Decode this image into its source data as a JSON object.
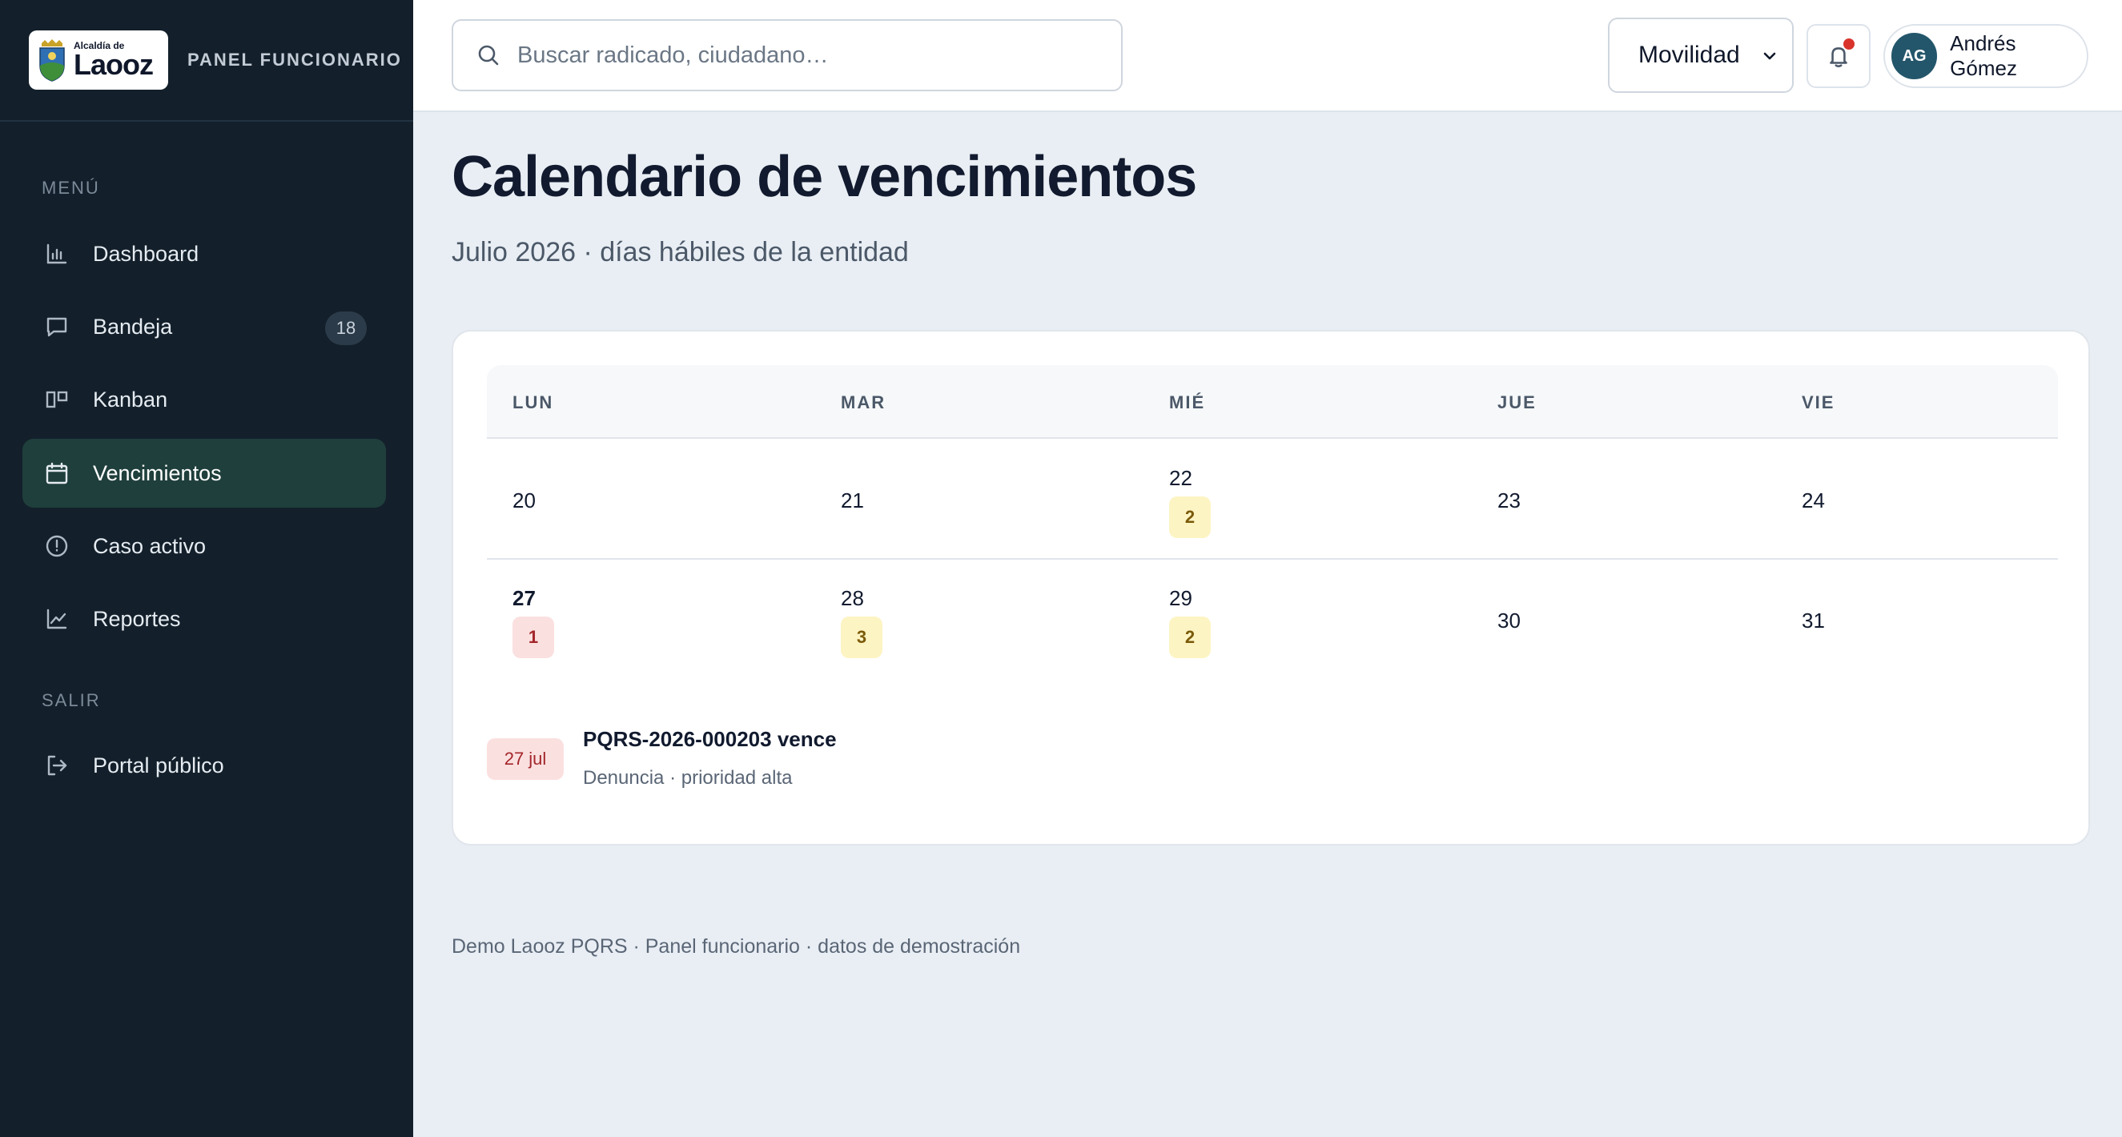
{
  "brand": {
    "logo_small": "Alcaldía de",
    "logo_big": "Laooz",
    "panel_label": "PANEL FUNCIONARIO"
  },
  "sidebar": {
    "menu_title": "MENÚ",
    "items": [
      {
        "label": "Dashboard",
        "icon": "bar-chart-icon"
      },
      {
        "label": "Bandeja",
        "icon": "inbox-icon",
        "badge": "18"
      },
      {
        "label": "Kanban",
        "icon": "kanban-icon"
      },
      {
        "label": "Vencimientos",
        "icon": "calendar-icon",
        "active": true
      },
      {
        "label": "Caso activo",
        "icon": "clock-icon"
      },
      {
        "label": "Reportes",
        "icon": "line-chart-icon"
      }
    ],
    "exit_title": "SALIR",
    "exit_item": {
      "label": "Portal público",
      "icon": "logout-icon"
    }
  },
  "topbar": {
    "search_placeholder": "Buscar radicado, ciudadano…",
    "dependency": "Movilidad",
    "user_initials": "AG",
    "user_name": "Andrés Gómez"
  },
  "page": {
    "title": "Calendario de vencimientos",
    "subtitle": "Julio 2026 · días hábiles de la entidad"
  },
  "calendar": {
    "days_of_week": [
      "LUN",
      "MAR",
      "MIÉ",
      "JUE",
      "VIE"
    ],
    "weeks": [
      [
        {
          "day": "20",
          "count": null
        },
        {
          "day": "21",
          "count": null
        },
        {
          "day": "22",
          "count": "2",
          "level": "warn"
        },
        {
          "day": "23",
          "count": null
        },
        {
          "day": "24",
          "count": null
        }
      ],
      [
        {
          "day": "27",
          "count": "1",
          "level": "alert",
          "today": true
        },
        {
          "day": "28",
          "count": "3",
          "level": "warn"
        },
        {
          "day": "29",
          "count": "2",
          "level": "warn"
        },
        {
          "day": "30",
          "count": null
        },
        {
          "day": "31",
          "count": null
        }
      ]
    ]
  },
  "event": {
    "date": "27 jul",
    "title": "PQRS-2026-000203 vence",
    "subtitle": "Denuncia · prioridad alta"
  },
  "footer": {
    "text": "Demo Laooz PQRS · Panel funcionario · datos de demostración"
  },
  "colors": {
    "sidebar_bg": "#13202b",
    "active_bg": "#1f3f3c",
    "warn_bg": "#fdf4c4",
    "alert_bg": "#fbe0e0",
    "avatar_bg": "#23566a"
  }
}
